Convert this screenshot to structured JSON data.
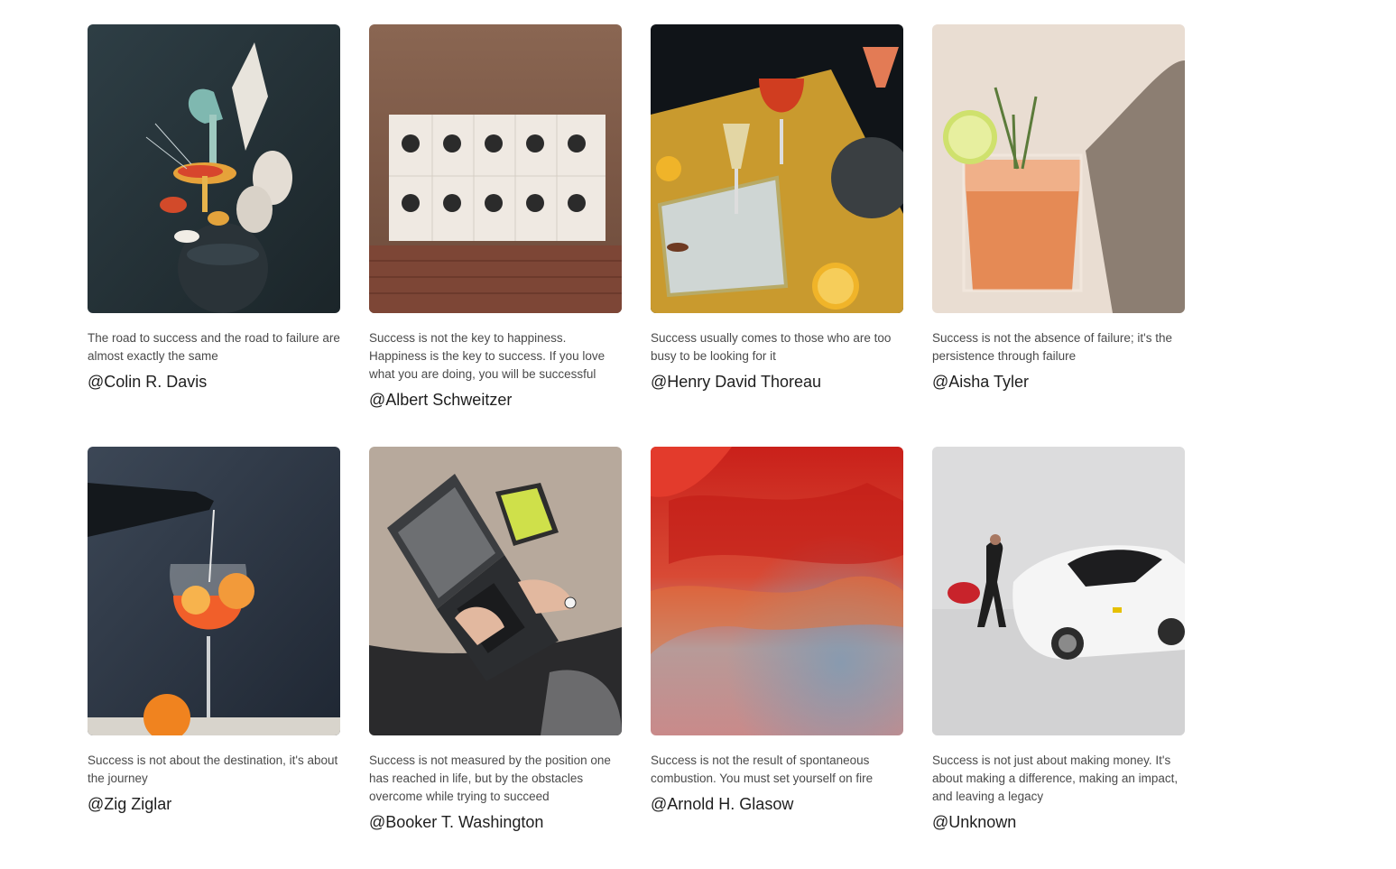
{
  "cards": [
    {
      "quote": "The road to success and the road to failure are almost exactly the same",
      "author": "@Colin R. Davis",
      "image": "mushroom-sculpture-photo"
    },
    {
      "quote": "Success is not the key to happiness. Happiness is the key to success. If you love what you are doing, you will be successful",
      "author": "@Albert Schweitzer",
      "image": "mailchimp-tiles-photo"
    },
    {
      "quote": "Success usually comes to those who are too busy to be looking for it",
      "author": "@Henry David Thoreau",
      "image": "cocktail-table-photo"
    },
    {
      "quote": "Success is not the absence of failure; it's the persistence through failure",
      "author": "@Aisha Tyler",
      "image": "lime-cocktail-photo"
    },
    {
      "quote": "Success is not about the destination, it's about the journey",
      "author": "@Zig Ziglar",
      "image": "spritz-pour-photo"
    },
    {
      "quote": "Success is not measured by the position one has reached in life, but by the obstacles overcome while trying to succeed",
      "author": "@Booker T. Washington",
      "image": "laptop-rug-photo"
    },
    {
      "quote": "Success is not the result of spontaneous combustion. You must set yourself on fire",
      "author": "@Arnold H. Glasow",
      "image": "red-dust-abstract-photo"
    },
    {
      "quote": "Success is not just about making money. It's about making a difference, making an impact, and leaving a legacy",
      "author": "@Unknown",
      "image": "white-sports-car-photo"
    }
  ]
}
